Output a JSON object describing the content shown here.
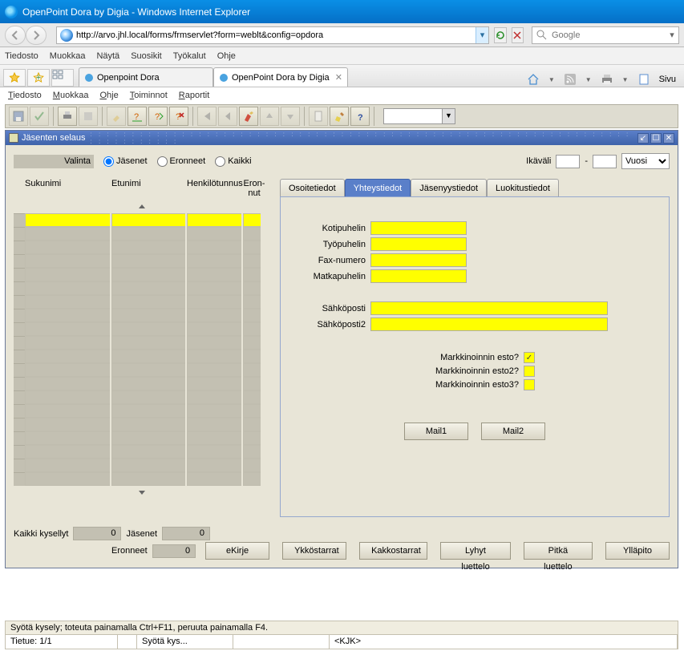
{
  "ieTitle": "OpenPoint Dora by Digia - Windows Internet Explorer",
  "addressUrl": "http://arvo.jhl.local/forms/frmservlet?form=weblt&config=opdora",
  "searchPlaceholder": "Google",
  "ieMenu": [
    "Tiedosto",
    "Muokkaa",
    "Näytä",
    "Suosikit",
    "Työkalut",
    "Ohje"
  ],
  "browserTabs": [
    {
      "label": "Openpoint Dora",
      "active": false
    },
    {
      "label": "OpenPoint Dora by Digia",
      "active": true
    }
  ],
  "ieTool_sivu": "Sivu",
  "appMenu": [
    {
      "label": "Tiedosto",
      "u": "T"
    },
    {
      "label": "Muokkaa",
      "u": "M"
    },
    {
      "label": "Ohje",
      "u": "O"
    },
    {
      "label": "Toiminnot",
      "u": "T"
    },
    {
      "label": "Raportit",
      "u": "R"
    }
  ],
  "subwinTitle": "Jäsenten selaus",
  "filter": {
    "valintaLabel": "Valinta",
    "jasenetLabel": "Jäsenet",
    "eronneetLabel": "Eronneet",
    "kaikkiLabel": "Kaikki",
    "ikavaliLabel": "Ikäväli",
    "dash": "-",
    "unit": "Vuosi"
  },
  "gridHeaders": {
    "sukunimi": "Sukunimi",
    "etunimi": "Etunimi",
    "henkilotunnus": "Henkilötunnus",
    "eronnut_l1": "Eron-",
    "eronnut_l2": "nut"
  },
  "tabs": {
    "osoite": "Osoitetiedot",
    "yhteys": "Yhteystiedot",
    "jasenyys": "Jäsenyystiedot",
    "luokitus": "Luokitustiedot"
  },
  "fields": {
    "koti": "Kotipuhelin",
    "tyo": "Työpuhelin",
    "fax": "Fax-numero",
    "matka": "Matkapuhelin",
    "email": "Sähköposti",
    "email2": "Sähköposti2"
  },
  "checks": {
    "m1": "Markkinoinnin esto?",
    "m2": "Markkinoinnin esto2?",
    "m3": "Markkinoinnin esto3?",
    "m1v": true,
    "m2v": false,
    "m3v": false
  },
  "mailbtn1": "Mail1",
  "mailbtn2": "Mail2",
  "counters": {
    "kaikkiLabel": "Kaikki kysellyt",
    "kaikkiVal": "0",
    "jasenetLabel": "Jäsenet",
    "jasenetVal": "0",
    "eronneetLabel": "Eronneet",
    "eronneetVal": "0"
  },
  "bottomButtons": [
    "eKirje",
    "Ykköstarrat",
    "Kakkostarrat",
    "Lyhyt luettelo",
    "Pitkä luettelo",
    "Ylläpito"
  ],
  "status": {
    "hint": "Syötä kysely; toteuta painamalla Ctrl+F11, peruuta painamalla F4.",
    "tietue": "Tietue: 1/1",
    "mode": "Syötä kys...",
    "user": "<KJK>"
  }
}
